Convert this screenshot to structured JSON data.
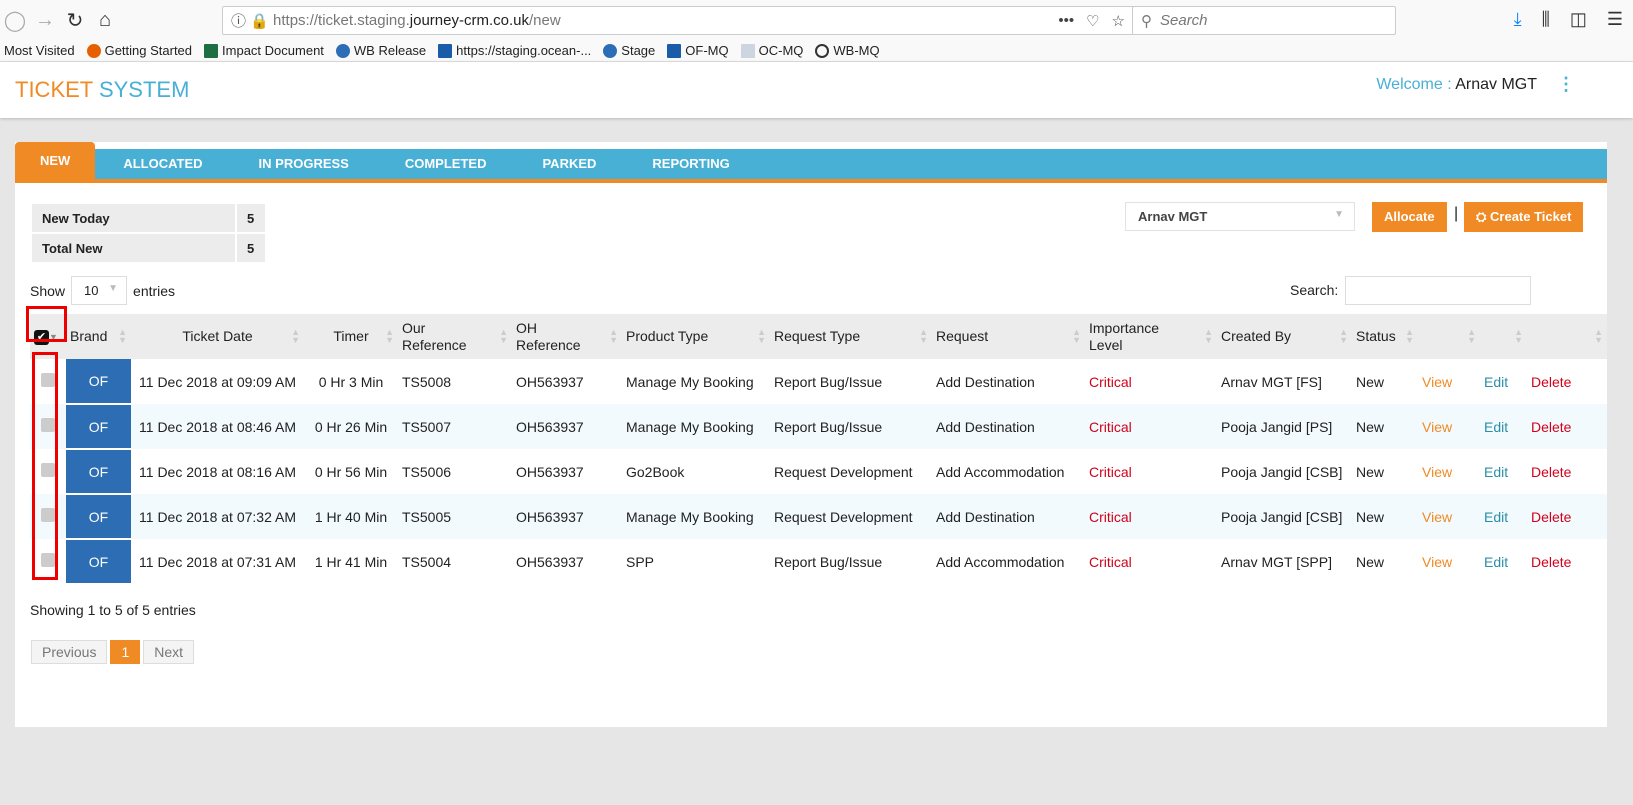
{
  "browser": {
    "url_prefix": "https://ticket.staging.",
    "url_domain": "journey-crm.co.uk",
    "url_path": "/new",
    "search_placeholder": "Search",
    "bookmarks": [
      "Most Visited",
      "Getting Started",
      "Impact Document",
      "WB Release",
      "https://staging.ocean-...",
      "Stage",
      "OF-MQ",
      "OC-MQ",
      "WB-MQ"
    ]
  },
  "header": {
    "logo_a": "TICKET",
    "logo_b": "SYSTEM",
    "welcome_label": "Welcome : ",
    "user": "Arnav MGT"
  },
  "tabs": [
    "NEW",
    "ALLOCATED",
    "IN PROGRESS",
    "COMPLETED",
    "PARKED",
    "REPORTING"
  ],
  "summary": [
    {
      "label": "New Today",
      "value": "5"
    },
    {
      "label": "Total New",
      "value": "5"
    }
  ],
  "assignee": "Arnav MGT",
  "allocate_label": "Allocate",
  "create_label": "Create Ticket",
  "separator": "|",
  "show_label": "Show",
  "page_length": "10",
  "entries_label": "entries",
  "search_label": "Search:",
  "columns": [
    "Brand",
    "Ticket Date",
    "Timer",
    "Our Reference",
    "OH Reference",
    "Product Type",
    "Request Type",
    "Request",
    "Importance Level",
    "Created By",
    "Status"
  ],
  "rows": [
    {
      "brand": "OF",
      "date": "11 Dec 2018 at 09:09 AM",
      "timer": "0 Hr 3 Min",
      "ref": "TS5008",
      "oh": "OH563937",
      "product": "Manage My Booking",
      "rtype": "Report Bug/Issue",
      "request": "Add Destination",
      "importance": "Critical",
      "created": "Arnav MGT [FS]",
      "status": "New",
      "view": "View",
      "edit": "Edit",
      "delete": "Delete"
    },
    {
      "brand": "OF",
      "date": "11 Dec 2018 at 08:46 AM",
      "timer": "0 Hr 26 Min",
      "ref": "TS5007",
      "oh": "OH563937",
      "product": "Manage My Booking",
      "rtype": "Report Bug/Issue",
      "request": "Add Destination",
      "importance": "Critical",
      "created": "Pooja Jangid [PS]",
      "status": "New",
      "view": "View",
      "edit": "Edit",
      "delete": "Delete"
    },
    {
      "brand": "OF",
      "date": "11 Dec 2018 at 08:16 AM",
      "timer": "0 Hr 56 Min",
      "ref": "TS5006",
      "oh": "OH563937",
      "product": "Go2Book",
      "rtype": "Request Development",
      "request": "Add Accommodation",
      "importance": "Critical",
      "created": "Pooja Jangid [CSB]",
      "status": "New",
      "view": "View",
      "edit": "Edit",
      "delete": "Delete"
    },
    {
      "brand": "OF",
      "date": "11 Dec 2018 at 07:32 AM",
      "timer": "1 Hr 40 Min",
      "ref": "TS5005",
      "oh": "OH563937",
      "product": "Manage My Booking",
      "rtype": "Request Development",
      "request": "Add Destination",
      "importance": "Critical",
      "created": "Pooja Jangid [CSB]",
      "status": "New",
      "view": "View",
      "edit": "Edit",
      "delete": "Delete"
    },
    {
      "brand": "OF",
      "date": "11 Dec 2018 at 07:31 AM",
      "timer": "1 Hr 41 Min",
      "ref": "TS5004",
      "oh": "OH563937",
      "product": "SPP",
      "rtype": "Report Bug/Issue",
      "request": "Add Accommodation",
      "importance": "Critical",
      "created": "Arnav MGT [SPP]",
      "status": "New",
      "view": "View",
      "edit": "Edit",
      "delete": "Delete"
    }
  ],
  "info": "Showing 1 to 5 of 5 entries",
  "pager": {
    "prev": "Previous",
    "page": "1",
    "next": "Next"
  },
  "colors": {
    "orange": "#ef8a24",
    "blue": "#48b0d5",
    "brand": "#2c6db3"
  }
}
